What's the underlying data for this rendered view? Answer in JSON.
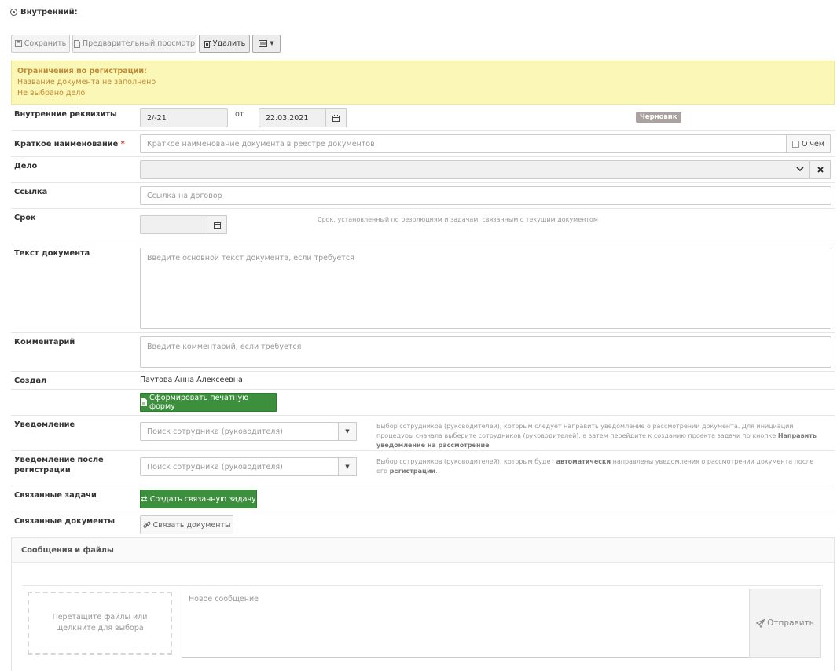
{
  "header": {
    "title": "Внутренний:"
  },
  "toolbar": {
    "save": "Сохранить",
    "preview": "Предварительный просмотр",
    "delete": "Удалить"
  },
  "alert": {
    "title": "Ограничения по регистрации:",
    "lines": [
      "Название документа не заполнено",
      "Не выбрано дело"
    ]
  },
  "form": {
    "requisites": {
      "label": "Внутренние реквизиты",
      "number": "2/-21",
      "from": "от",
      "date": "22.03.2021",
      "status": "Черновик"
    },
    "short_name": {
      "label": "Краткое наименование",
      "required_mark": "*",
      "placeholder": "Краткое наименование документа в реестре документов",
      "about": "О чем"
    },
    "case": {
      "label": "Дело"
    },
    "link": {
      "label": "Ссылка",
      "placeholder": "Ссылка на договор"
    },
    "deadline": {
      "label": "Срок",
      "hint": "Срок, установленный по резолюциям и задачам, связанным с текущим документом"
    },
    "text": {
      "label": "Текст документа",
      "placeholder": "Введите основной текст документа, если требуется"
    },
    "comment": {
      "label": "Комментарий",
      "placeholder": "Введите комментарий, если требуется"
    },
    "creator": {
      "label": "Создал",
      "value": "Паутова Анна Алексеевна"
    },
    "print_button": "Сформировать печатную форму",
    "notify": {
      "label": "Уведомление",
      "placeholder": "Поиск сотрудника (руководителя)",
      "hint_1": "Выбор сотрудников (руководителей), которым следует направить уведомление о рассмотрении документа. Для инициации процедуры сначала выберите сотрудников (руководителей), а затем перейдите к созданию проекта задачи по кнопке",
      "hint_bold": "Направить уведомление на рассмотрение"
    },
    "notify_after": {
      "label_1": "Уведомление после",
      "label_2": "регистрации",
      "placeholder": "Поиск сотрудника (руководителя)",
      "hint_1": "Выбор сотрудников (руководителей), которым будет",
      "hint_bold_1": "автоматически",
      "hint_2": "направлены уведомления о рассмотрении документа после его",
      "hint_bold_2": "регистрации",
      "hint_3": "."
    },
    "linked_tasks": {
      "label": "Связанные задачи",
      "button": "Создать связанную задачу"
    },
    "linked_docs": {
      "label": "Связанные документы",
      "button": "Связать документы"
    }
  },
  "messages": {
    "title": "Сообщения и файлы",
    "dropzone": "Перетащите файлы или щелкните для выбора",
    "placeholder": "Новое сообщение",
    "send": "Отправить"
  },
  "colors": {
    "green": "#3c8f3c",
    "alert_bg": "#fbf7b6",
    "alert_text": "#c08a36",
    "badge": "#aaa29e"
  }
}
